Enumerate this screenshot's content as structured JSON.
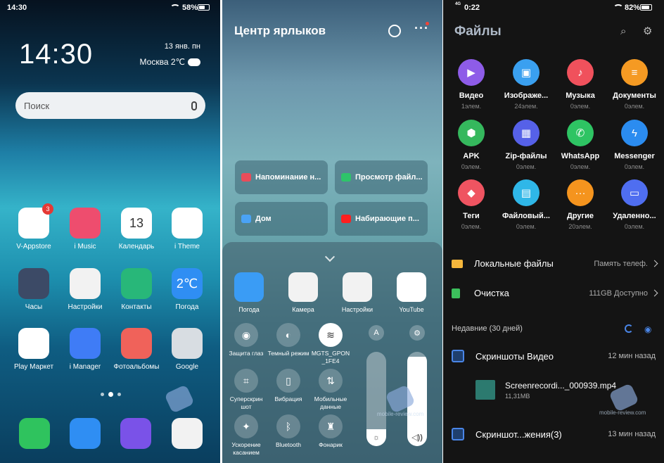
{
  "home": {
    "status_time": "14:30",
    "battery": "58%",
    "battery_level": 0.58,
    "clock": "14:30",
    "date": "13 янв. пн",
    "weather": "Москва 2℃",
    "search_placeholder": "Поиск",
    "apps": [
      {
        "label": "V-Appstore",
        "badge": "3",
        "color": "#ffffff",
        "icon": "vivo-appstore-icon"
      },
      {
        "label": "i Music",
        "color": "#ee4d6e",
        "icon": "music-note-icon"
      },
      {
        "label": "Календарь",
        "color": "#ffffff",
        "icon": "calendar-icon",
        "text": "13",
        "subtext": "Пн"
      },
      {
        "label": "i Theme",
        "color": "#ffffff",
        "icon": "theme-gem-icon"
      },
      {
        "label": "Часы",
        "color": "#3c4a66",
        "icon": "clock-icon"
      },
      {
        "label": "Настройки",
        "color": "#f2f2f2",
        "icon": "gear-icon"
      },
      {
        "label": "Контакты",
        "color": "#28b779",
        "icon": "contacts-icon"
      },
      {
        "label": "Погода",
        "color": "#2f8ef3",
        "icon": "weather-icon",
        "text": "2℃"
      },
      {
        "label": "Play Маркет",
        "color": "#ffffff",
        "icon": "play-store-icon"
      },
      {
        "label": "i Manager",
        "color": "#3f7cf6",
        "icon": "shield-check-icon"
      },
      {
        "label": "Фотоальбомы",
        "color": "#f0625a",
        "icon": "photo-icon"
      },
      {
        "label": "Google",
        "color": "#d8dde2",
        "icon": "google-folder-icon"
      }
    ],
    "dock": [
      {
        "name": "phone-icon",
        "color": "#2fc35e"
      },
      {
        "name": "messages-icon",
        "color": "#2f8ef3"
      },
      {
        "name": "browser-planet-icon",
        "color": "#7a52e8"
      },
      {
        "name": "camera-icon",
        "color": "#f2f2f2"
      }
    ]
  },
  "shortcuts": {
    "title": "Центр ярлыков",
    "cards": [
      {
        "label": "Напоминание н...",
        "color": "#e84c5a",
        "icon": "calendar-icon"
      },
      {
        "label": "Просмотр файл...",
        "color": "#2ec46a",
        "icon": "eye-icon"
      },
      {
        "label": "Дом",
        "color": "#4aa3f5",
        "icon": "maps-icon"
      },
      {
        "label": "Набирающие п...",
        "color": "#ff1f1f",
        "icon": "youtube-icon"
      }
    ],
    "apps": [
      {
        "label": "Погода",
        "color": "#3a9cf5",
        "icon": "weather-icon"
      },
      {
        "label": "Камера",
        "color": "#f2f2f2",
        "icon": "camera-icon"
      },
      {
        "label": "Настройки",
        "color": "#f2f2f2",
        "icon": "gear-icon"
      },
      {
        "label": "YouTube",
        "color": "#ffffff",
        "icon": "youtube-icon"
      }
    ],
    "toggles": [
      {
        "label": "Защита глаз",
        "glyph": "◉",
        "on": false
      },
      {
        "label": "Темный режим",
        "glyph": "◐",
        "on": false
      },
      {
        "label": "MGTS_GPON _1FE4",
        "glyph": "≋",
        "on": true
      },
      {
        "label": "Суперскрин шот",
        "glyph": "⌗",
        "on": false
      },
      {
        "label": "Вибрация",
        "glyph": "▯",
        "on": false
      },
      {
        "label": "Мобильные данные",
        "glyph": "⇅",
        "on": false
      },
      {
        "label": "Ускорение касанием",
        "glyph": "✦",
        "on": false
      },
      {
        "label": "Bluetooth",
        "glyph": "ᛒ",
        "on": false
      },
      {
        "label": "Фонарик",
        "glyph": "♜",
        "on": false
      }
    ],
    "auto_brightness": "A",
    "brightness_level": 0.18,
    "volume_level": 0.95
  },
  "files": {
    "status_time": "0:22",
    "battery": "82%",
    "battery_level": 0.82,
    "network": "4G",
    "title": "Файлы",
    "categories": [
      {
        "name": "Видео",
        "count": "1элем.",
        "color": "#8e5ce8",
        "glyph": "▶"
      },
      {
        "name": "Изображе...",
        "count": "24элем.",
        "color": "#3aa0f0",
        "glyph": "▣"
      },
      {
        "name": "Музыка",
        "count": "0элем.",
        "color": "#f0515c",
        "glyph": "♪"
      },
      {
        "name": "Документы",
        "count": "0элем.",
        "color": "#f59a23",
        "glyph": "≡"
      },
      {
        "name": "APK",
        "count": "0элем.",
        "color": "#35b85d",
        "glyph": "⬢"
      },
      {
        "name": "Zip-файлы",
        "count": "0элем.",
        "color": "#5661e8",
        "glyph": "▦"
      },
      {
        "name": "WhatsApp",
        "count": "0элем.",
        "color": "#2ec463",
        "glyph": "✆"
      },
      {
        "name": "Messenger",
        "count": "0элем.",
        "color": "#2b8cf0",
        "glyph": "ϟ"
      },
      {
        "name": "Теги",
        "count": "0элем.",
        "color": "#ef5461",
        "glyph": "◆"
      },
      {
        "name": "Файловый...",
        "count": "0элем.",
        "color": "#2fb7e8",
        "glyph": "▤"
      },
      {
        "name": "Другие",
        "count": "20элем.",
        "color": "#f5941e",
        "glyph": "···"
      },
      {
        "name": "Удаленно...",
        "count": "0элем.",
        "color": "#4f6ef0",
        "glyph": "▭"
      }
    ],
    "local_files": {
      "label": "Локальные файлы",
      "value": "Память телеф."
    },
    "cleanup": {
      "label": "Очистка",
      "value": "111GB Доступно"
    },
    "recent_label": "Недавние (30 дней)",
    "groups": [
      {
        "name": "Скриншоты Видео",
        "time": "12 мин назад"
      },
      {
        "name": "Скриншот...жения(3)",
        "time": "13 мин назад"
      }
    ],
    "file": {
      "name": "Screenrecordi..._000939.mp4",
      "size": "11,31MB"
    }
  },
  "watermark": "mobile-review.com"
}
